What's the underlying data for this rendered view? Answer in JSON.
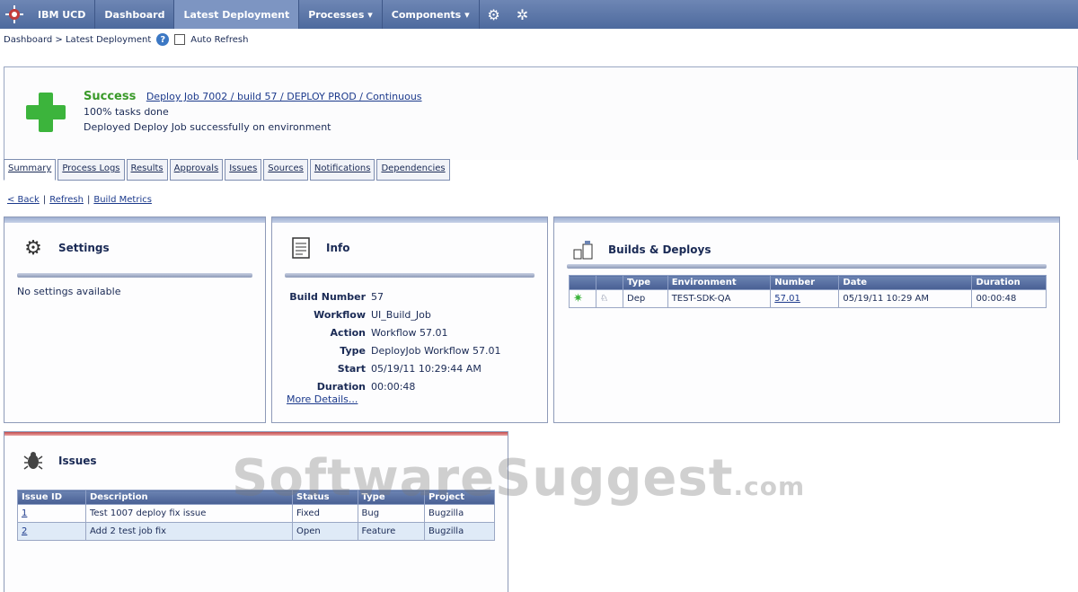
{
  "nav": {
    "items": [
      {
        "label": "IBM UCD",
        "active": false
      },
      {
        "label": "Dashboard",
        "active": false
      },
      {
        "label": "Latest Deployment",
        "active": true
      },
      {
        "label": "Processes",
        "active": false,
        "dropdown": true
      },
      {
        "label": "Components",
        "active": false,
        "dropdown": true
      }
    ],
    "icons": [
      "settings-icon",
      "help-icon"
    ]
  },
  "breadcrumb": {
    "text": "Dashboard > Latest Deployment",
    "auto_refresh_label": "Auto Refresh"
  },
  "status": {
    "title": "Success",
    "link": "Deploy Job 7002 / build 57 / DEPLOY PROD / Continuous",
    "line2": "100% tasks done",
    "line3": "Deployed Deploy Job successfully on environment"
  },
  "tabs": [
    "Summary",
    "Process Logs",
    "Results",
    "Approvals",
    "Issues",
    "Sources",
    "Notifications",
    "Dependencies"
  ],
  "links": {
    "back": "< Back",
    "refresh": "Refresh",
    "metrics": "Build Metrics"
  },
  "settings": {
    "title": "Settings",
    "empty_text": "No settings available"
  },
  "info": {
    "title": "Info",
    "rows": [
      {
        "key": "Build Number",
        "value": "57"
      },
      {
        "key": "Workflow",
        "value": "UI_Build_Job"
      },
      {
        "key": "Action",
        "value": "Workflow 57.01"
      },
      {
        "key": "Type",
        "value": "DeployJob Workflow 57.01"
      },
      {
        "key": "Start",
        "value": "05/19/11 10:29:44 AM"
      },
      {
        "key": "Duration",
        "value": "00:00:48"
      }
    ],
    "more": "More Details..."
  },
  "builds": {
    "title": "Builds & Deploys",
    "columns": [
      "",
      "",
      "Type",
      "Environment",
      "Number",
      "Date",
      "Duration"
    ],
    "rows": [
      {
        "type": "Dep",
        "environment": "TEST-SDK-QA",
        "number": "57.01",
        "date": "05/19/11 10:29 AM",
        "duration": "00:00:48"
      }
    ]
  },
  "issues": {
    "title": "Issues",
    "columns": [
      "Issue ID",
      "Description",
      "Status",
      "Type",
      "Project"
    ],
    "rows": [
      {
        "id": "1",
        "description": "Test 1007 deploy fix issue",
        "status": "Fixed",
        "type": "Bug",
        "project": "Bugzilla"
      },
      {
        "id": "2",
        "description": "Add 2 test job fix",
        "status": "Open",
        "type": "Feature",
        "project": "Bugzilla"
      }
    ]
  },
  "watermark": {
    "text": "SoftwareSuggest",
    "domain": ".com"
  }
}
